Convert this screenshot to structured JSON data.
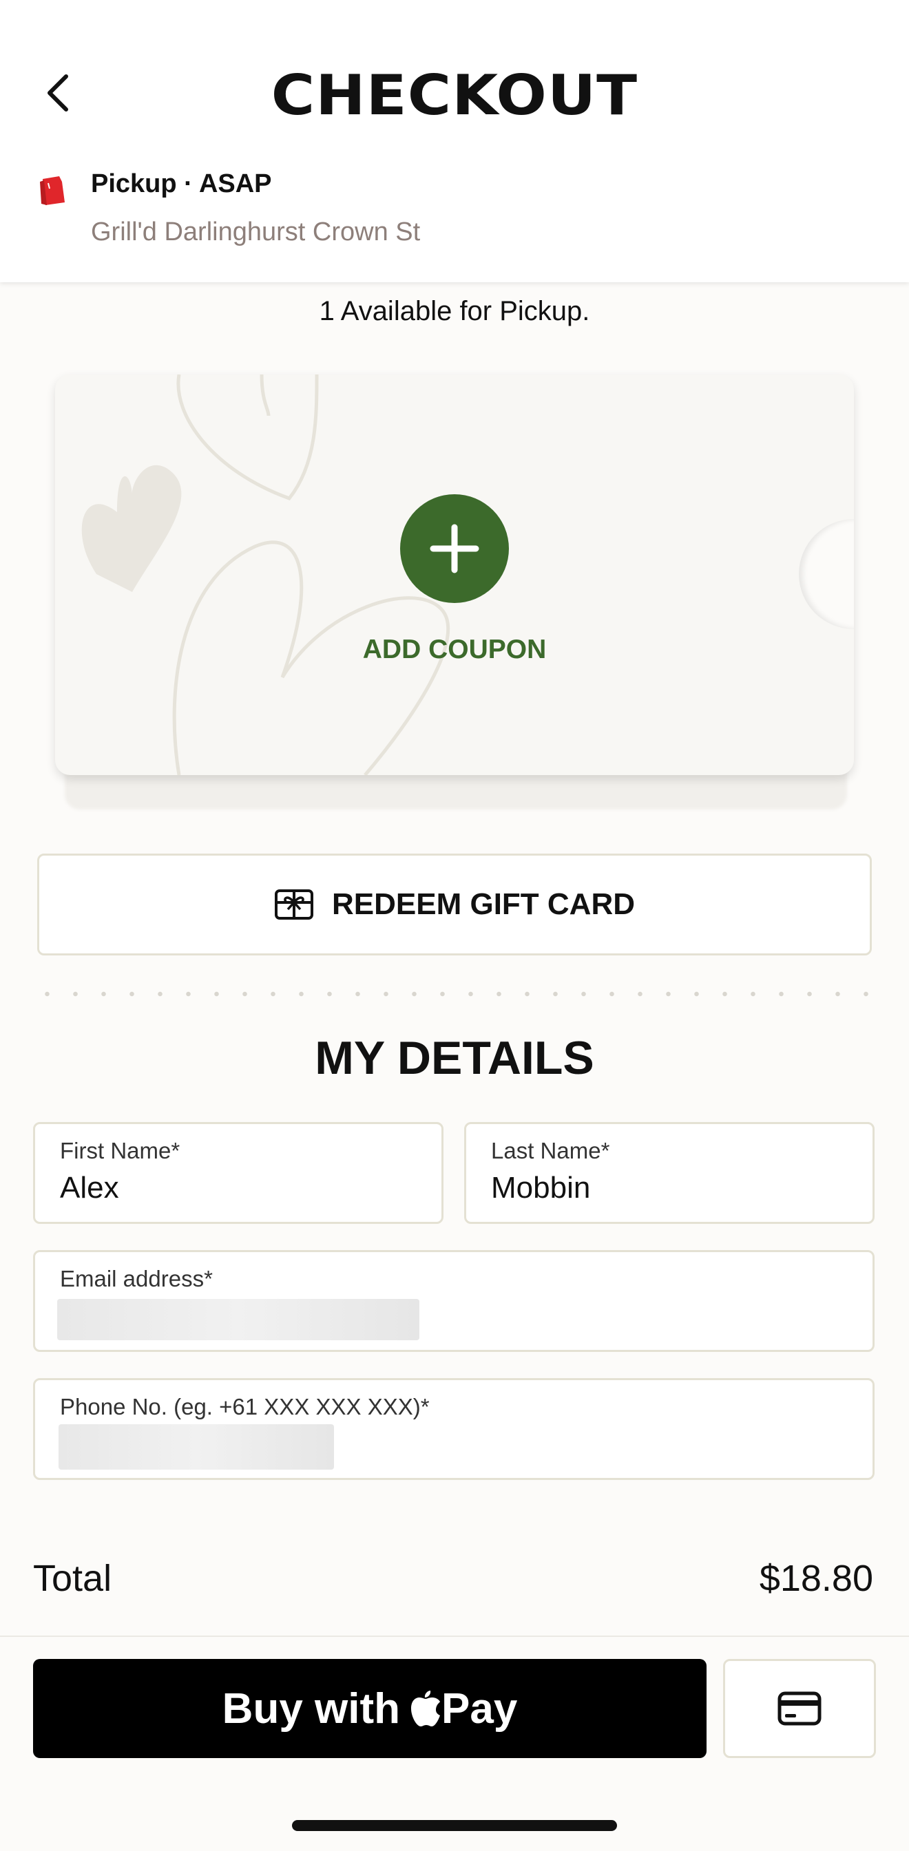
{
  "header": {
    "title": "CHECKOUT",
    "back_icon": "chevron-left-icon",
    "order_type": "Pickup · ASAP",
    "store": "Grill'd Darlinghurst Crown St",
    "store_icon": "shopping-bag-icon"
  },
  "coupon": {
    "availability": "1 Available for Pickup.",
    "add_label": "ADD COUPON",
    "add_icon": "plus-icon"
  },
  "gift_card": {
    "label": "REDEEM GIFT CARD",
    "icon": "gift-card-icon"
  },
  "details": {
    "title": "MY DETAILS",
    "first_name": {
      "label": "First Name*",
      "value": "Alex"
    },
    "last_name": {
      "label": "Last Name*",
      "value": "Mobbin"
    },
    "email": {
      "label": "Email address*"
    },
    "phone": {
      "label": "Phone No. (eg. +61 XXX XXX XXX)*"
    }
  },
  "summary": {
    "total_label": "Total",
    "total_value": "$18.80"
  },
  "payment": {
    "apple_pay_label": "Buy with",
    "apple_pay_brand": "Pay",
    "card_icon": "credit-card-icon"
  },
  "colors": {
    "accent_green": "#3c6a2b",
    "border": "#e4e1d3",
    "muted_text": "#8d7f7a",
    "store_icon_red": "#e0262b"
  }
}
